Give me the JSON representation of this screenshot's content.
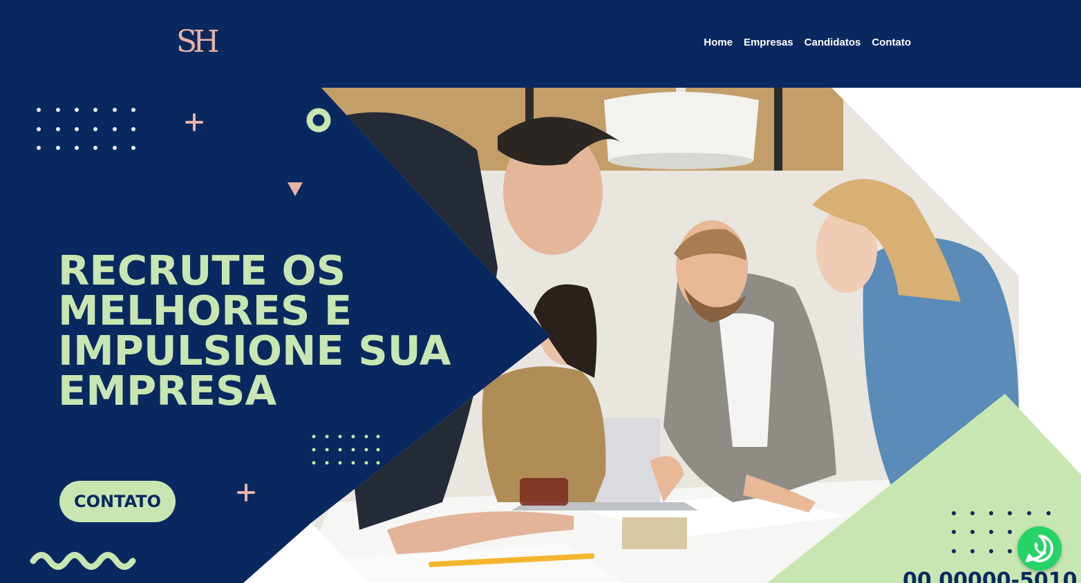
{
  "brand": {
    "logo_text": "SH",
    "logo_color": "#e9b3a4"
  },
  "nav": {
    "items": [
      {
        "label": "Home"
      },
      {
        "label": "Empresas"
      },
      {
        "label": "Candidatos"
      },
      {
        "label": "Contato"
      }
    ]
  },
  "hero": {
    "headline": "RECRUTE OS\nMELHORES E\nIMPULSIONE SUA\nEMPRESA",
    "cta_label": "CONTATO",
    "phone_partial": "00 00000-5010"
  },
  "colors": {
    "navy": "#0a2860",
    "mint": "#c8e6b1",
    "peach": "#e9b3a4",
    "whatsapp": "#25d366"
  },
  "icons": {
    "whatsapp": "whatsapp-icon"
  }
}
